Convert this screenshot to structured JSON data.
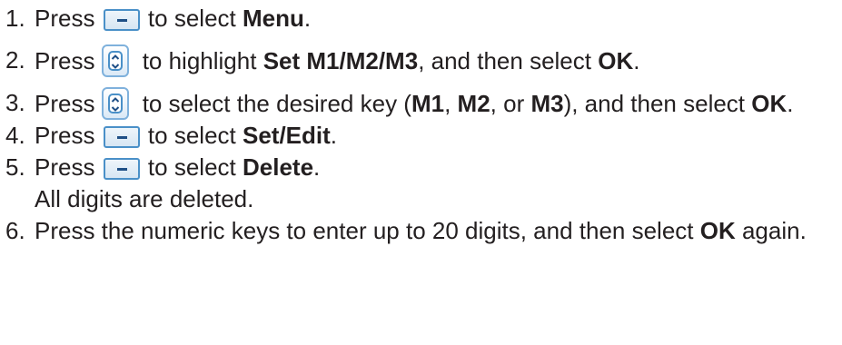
{
  "icons": {
    "soft_key": "soft-key-minus-icon",
    "nav_key": "navigation-up-down-icon"
  },
  "colors": {
    "text": "#231f20",
    "icon_border": "#4a90c8",
    "icon_bar": "#1f4f86"
  },
  "steps": [
    {
      "number": "1.",
      "press": "Press",
      "after_icon": " to select ",
      "bold": "Menu",
      "end": "."
    },
    {
      "number": "2.",
      "press": "Press",
      "after_icon": " to highlight ",
      "bold": "Set M1/M2/M3",
      "middle": ", and then select ",
      "bold2": "OK",
      "end": "."
    },
    {
      "number": "3.",
      "press": "Press",
      "after_icon": " to select the desired key (",
      "bold": "M1",
      "sep1": ", ",
      "bold2": "M2",
      "sep2": ", or ",
      "bold3": "M3",
      "middle": "), and then select ",
      "bold4": "OK",
      "end": "."
    },
    {
      "number": "4.",
      "press": "Press",
      "after_icon": " to select ",
      "bold": "Set/Edit",
      "end": "."
    },
    {
      "number": "5.",
      "press": "Press",
      "after_icon": " to select ",
      "bold": "Delete",
      "end": ".",
      "note": "All digits are deleted."
    },
    {
      "number": "6.",
      "text": "Press the numeric keys to enter up to 20 digits, and then select ",
      "bold": "OK",
      "end": " again."
    }
  ]
}
